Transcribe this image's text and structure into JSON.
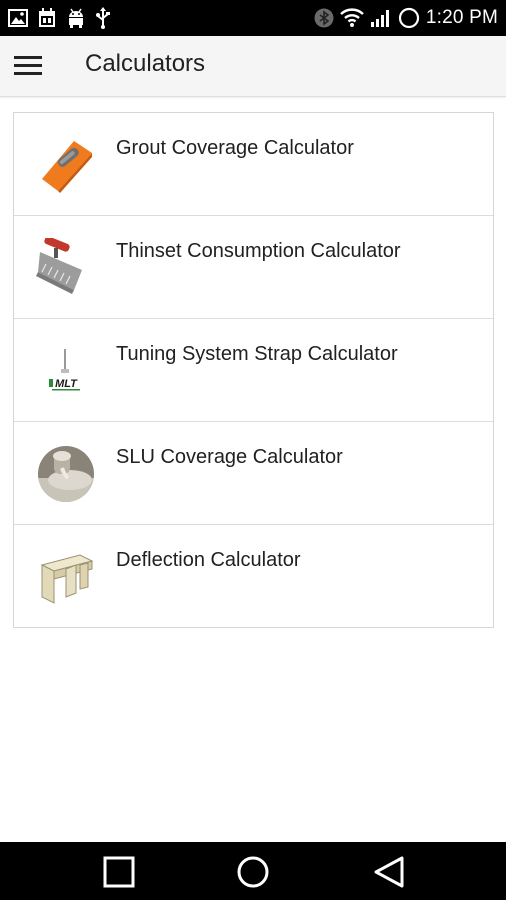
{
  "status_bar": {
    "time": "1:20 PM",
    "left_icons": [
      "gallery-icon",
      "calendar-icon",
      "android-icon",
      "usb-icon"
    ],
    "right_icons": [
      "bluetooth-icon",
      "wifi-icon",
      "signal-icon",
      "alarm-ring-icon"
    ]
  },
  "app_bar": {
    "menu_icon": "hamburger-menu-icon",
    "title": "Calculators"
  },
  "calculators": [
    {
      "label": "Grout Coverage Calculator",
      "icon": "grout-float-icon"
    },
    {
      "label": "Thinset Consumption Calculator",
      "icon": "notched-trowel-icon"
    },
    {
      "label": "Tuning System Strap Calculator",
      "icon": "mlt-strap-icon"
    },
    {
      "label": "SLU Coverage Calculator",
      "icon": "slu-pour-icon"
    },
    {
      "label": "Deflection Calculator",
      "icon": "joist-beam-icon"
    }
  ],
  "nav_bar": {
    "recent_icon": "recent-apps-icon",
    "home_icon": "home-circle-icon",
    "back_icon": "back-triangle-icon"
  },
  "colors": {
    "status_bar_bg": "#000000",
    "app_bar_bg": "#f5f5f5",
    "text_primary": "#212121",
    "divider": "#dcdcdc",
    "grout_float_orange": "#f07a1e"
  }
}
